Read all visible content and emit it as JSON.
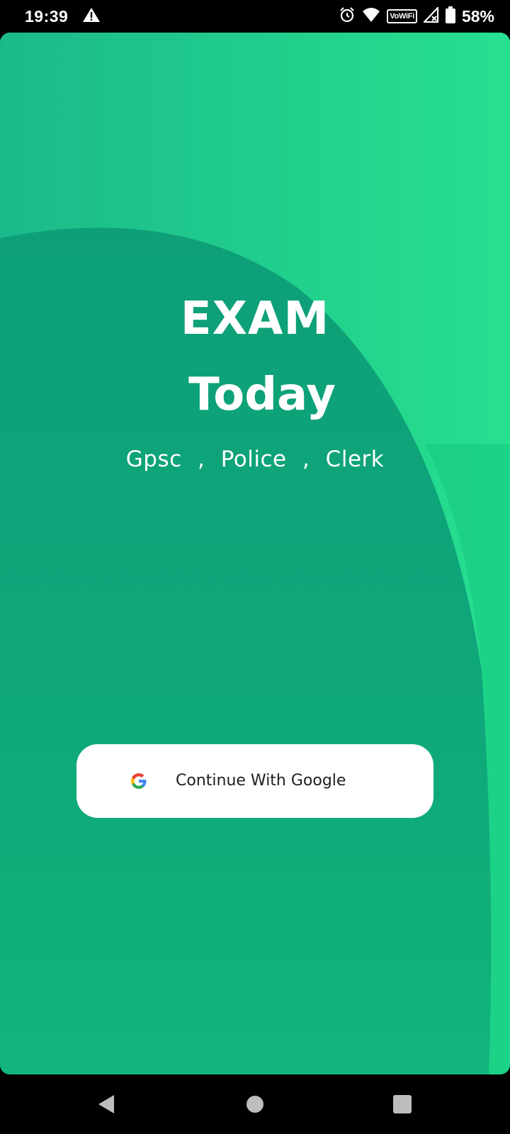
{
  "status_bar": {
    "time": "19:39",
    "battery_percent": "58%",
    "wifi_calling_label": "VoWiFi",
    "icons": [
      "warning-icon",
      "alarm-icon",
      "wifi-icon",
      "signal-icon",
      "battery-icon"
    ]
  },
  "app": {
    "title_line1": "EXAM",
    "title_line2": "Today",
    "subtitle": "Gpsc ,  Police ,  Clerk",
    "google_button_label": "Continue With Google"
  },
  "nav_bar": {
    "icons": [
      "back-icon",
      "home-icon",
      "recents-icon"
    ]
  },
  "colors": {
    "background_dark": "#0fa67a",
    "background_light": "#22d38e",
    "text": "#ffffff",
    "button_bg": "#ffffff"
  }
}
